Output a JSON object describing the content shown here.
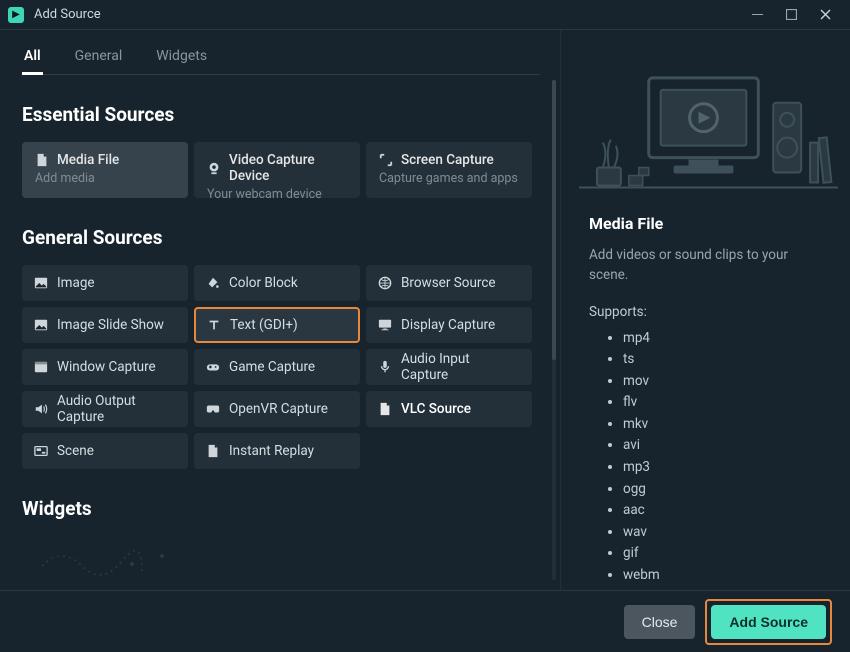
{
  "window": {
    "title": "Add Source"
  },
  "tabs": {
    "all": "All",
    "general": "General",
    "widgets": "Widgets"
  },
  "sections": {
    "essential": "Essential Sources",
    "general": "General Sources",
    "widgets": "Widgets"
  },
  "essential": {
    "media_file": {
      "title": "Media File",
      "sub": "Add media"
    },
    "video_capture": {
      "title": "Video Capture Device",
      "sub": "Your webcam device"
    },
    "screen_capture": {
      "title": "Screen Capture",
      "sub": "Capture games and apps"
    }
  },
  "general": {
    "image": "Image",
    "color_block": "Color Block",
    "browser_source": "Browser Source",
    "image_slide_show": "Image Slide Show",
    "text_gdi": "Text (GDI+)",
    "display_capture": "Display Capture",
    "window_capture": "Window Capture",
    "game_capture": "Game Capture",
    "audio_input_capture": "Audio Input Capture",
    "audio_output_capture": "Audio Output Capture",
    "openvr_capture": "OpenVR Capture",
    "vlc_source": "VLC Source",
    "scene": "Scene",
    "instant_replay": "Instant Replay"
  },
  "detail": {
    "title": "Media File",
    "desc": "Add videos or sound clips to your scene.",
    "supports_label": "Supports:",
    "formats": [
      "mp4",
      "ts",
      "mov",
      "flv",
      "mkv",
      "avi",
      "mp3",
      "ogg",
      "aac",
      "wav",
      "gif",
      "webm"
    ]
  },
  "footer": {
    "close": "Close",
    "add_source": "Add Source"
  }
}
